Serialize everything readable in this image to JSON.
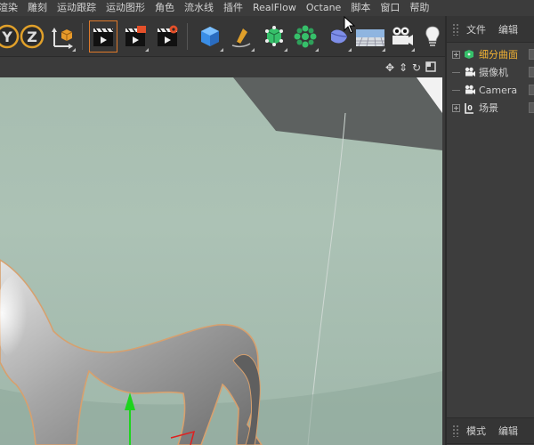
{
  "menu": [
    "渲染",
    "雕刻",
    "运动跟踪",
    "运动图形",
    "角色",
    "流水线",
    "插件",
    "RealFlow",
    "Octane",
    "脚本",
    "窗口",
    "帮助"
  ],
  "toolbar": {
    "axis_y": "Y",
    "axis_z": "Z"
  },
  "objects_panel": {
    "menu": [
      "文件",
      "编辑"
    ],
    "items": [
      {
        "label": "细分曲面",
        "icon": "subdivision-surface-icon",
        "active": true
      },
      {
        "label": "摄像机",
        "icon": "camera-icon",
        "active": false
      },
      {
        "label": "Camera",
        "icon": "camera-icon",
        "active": false
      },
      {
        "label": "场景",
        "icon": "null-object-icon",
        "active": false
      }
    ]
  },
  "attributes_panel": {
    "menu": [
      "模式",
      "编辑"
    ]
  },
  "colors": {
    "viewport_bg": "#a7bdb0",
    "active_object": "#f2b233",
    "y_axis": "#1dd41d"
  }
}
